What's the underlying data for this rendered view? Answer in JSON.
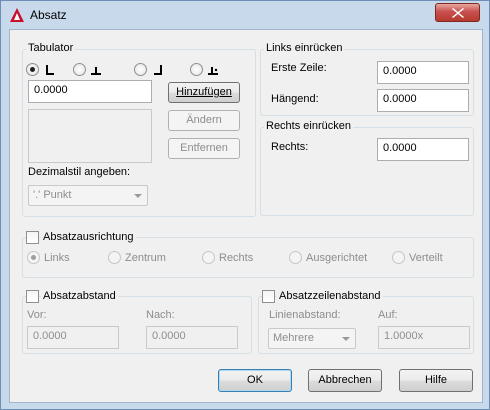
{
  "window": {
    "title": "Absatz"
  },
  "tabulator": {
    "group_label": "Tabulator",
    "tab_value": "0.0000",
    "add_button": "Hinzufügen",
    "change_button": "Ändern",
    "remove_button": "Entfernen",
    "decimal_style_label": "Dezimalstil angeben:",
    "decimal_style_value": "'.' Punkt"
  },
  "links": {
    "group_label": "Links einrücken",
    "first_line_label": "Erste Zeile:",
    "first_line_value": "0.0000",
    "hanging_label": "Hängend:",
    "hanging_value": "0.0000"
  },
  "rechts": {
    "group_label": "Rechts einrücken",
    "right_label": "Rechts:",
    "right_value": "0.0000"
  },
  "alignment": {
    "checkbox_label": "Absatzausrichtung",
    "options": [
      "Links",
      "Zentrum",
      "Rechts",
      "Ausgerichtet",
      "Verteilt"
    ]
  },
  "spacing": {
    "checkbox_label": "Absatzabstand",
    "before_label": "Vor:",
    "before_value": "0.0000",
    "after_label": "Nach:",
    "after_value": "0.0000"
  },
  "line_spacing": {
    "checkbox_label": "Absatzzeilenabstand",
    "spacing_label": "Linienabstand:",
    "spacing_value": "Mehrere",
    "at_label": "Auf:",
    "at_value": "1.0000x"
  },
  "buttons": {
    "ok": "OK",
    "cancel": "Abbrechen",
    "help": "Hilfe"
  },
  "colors": {
    "title_bar": "#c9d9ec",
    "close_button": "#c75050",
    "app_icon": "#c8102e"
  }
}
